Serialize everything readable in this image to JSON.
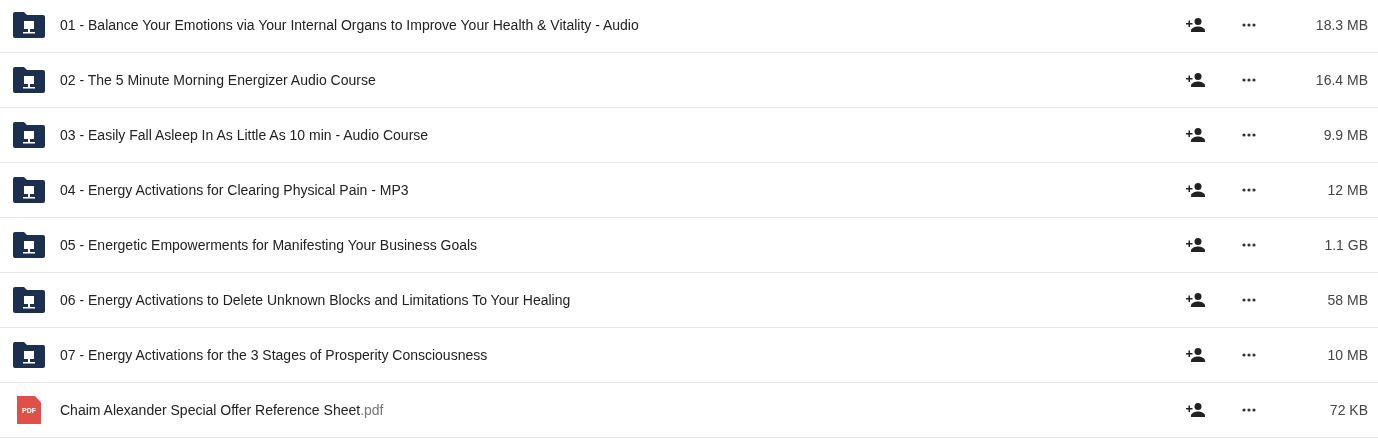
{
  "files": [
    {
      "kind": "folder",
      "name": "01 - Balance Your Emotions via Your Internal Organs to Improve Your Health & Vitality - Audio",
      "size": "18.3 MB"
    },
    {
      "kind": "folder",
      "name": "02 - The 5 Minute Morning Energizer Audio Course",
      "size": "16.4 MB"
    },
    {
      "kind": "folder",
      "name": "03 - Easily Fall Asleep In As Little As 10 min - Audio Course",
      "size": "9.9 MB"
    },
    {
      "kind": "folder",
      "name": "04 - Energy Activations for Clearing Physical Pain - MP3",
      "size": "12 MB"
    },
    {
      "kind": "folder",
      "name": "05 - Energetic Empowerments for Manifesting Your Business Goals",
      "size": "1.1 GB"
    },
    {
      "kind": "folder",
      "name": "06 - Energy Activations to Delete Unknown Blocks and Limitations To Your Healing",
      "size": "58 MB"
    },
    {
      "kind": "folder",
      "name": "07 - Energy Activations for the 3 Stages of Prosperity Consciousness",
      "size": "10 MB"
    },
    {
      "kind": "pdf",
      "icon_label": "PDF",
      "name": "Chaim Alexander Special Offer Reference Sheet",
      "extension": ".pdf",
      "size": "72 KB"
    }
  ]
}
